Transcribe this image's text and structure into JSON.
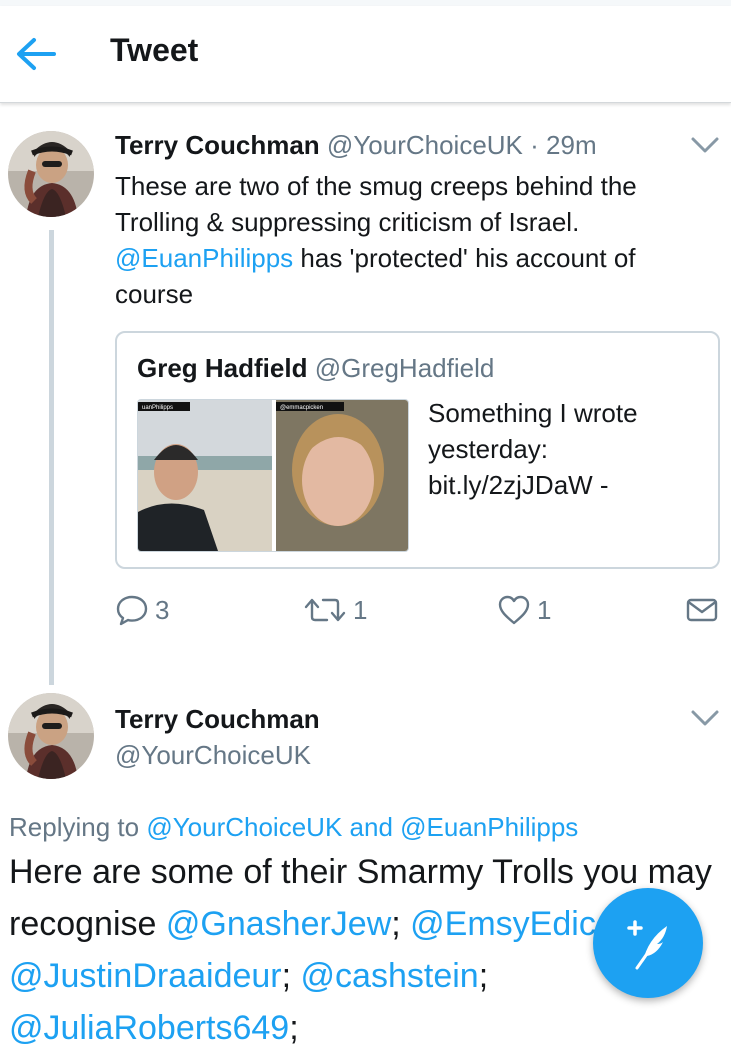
{
  "header": {
    "title": "Tweet",
    "back_icon": "arrow-left-icon",
    "accent": "#1da1f2"
  },
  "tweet": {
    "author_name": "Terry Couchman",
    "author_handle": "@YourChoiceUK",
    "separator": "·",
    "time": "29m",
    "text_line1": "These are two of the smug creeps behind the Trolling & suppressing criticism of Israel.",
    "mention": "@EuanPhilipps",
    "text_line2": " has 'protected' his account of course",
    "quote": {
      "author_name": "Greg Hadfield",
      "author_handle": "@GregHadfield",
      "text": "Something I wrote yesterday: bit.ly/2zjJDaW -",
      "image_label_left": "uanPhilipps",
      "image_label_right": "@emmacpicken"
    },
    "actions": {
      "reply_count": "3",
      "retweet_count": "1",
      "like_count": "1"
    }
  },
  "reply": {
    "author_name": "Terry Couchman",
    "author_handle": "@YourChoiceUK",
    "replying_prefix": "Replying to ",
    "replying_to_1": "@YourChoiceUK",
    "replying_and": " and ",
    "replying_to_2": "@EuanPhilipps",
    "text_part1": "Here are some of their Smarmy Trolls you may recognise ",
    "mention_1": "@GnasherJew",
    "sep_1": "; ",
    "mention_2": "@EmsyEdicorn",
    "sep_2": "; ",
    "mention_3": "@JustinDraaideur",
    "sep_3": "; ",
    "mention_4": "@cashstein",
    "sep_4": "; ",
    "mention_5": "@JuliaRoberts649",
    "sep_5": ";"
  },
  "compose": {
    "icon": "compose-quill-icon"
  }
}
